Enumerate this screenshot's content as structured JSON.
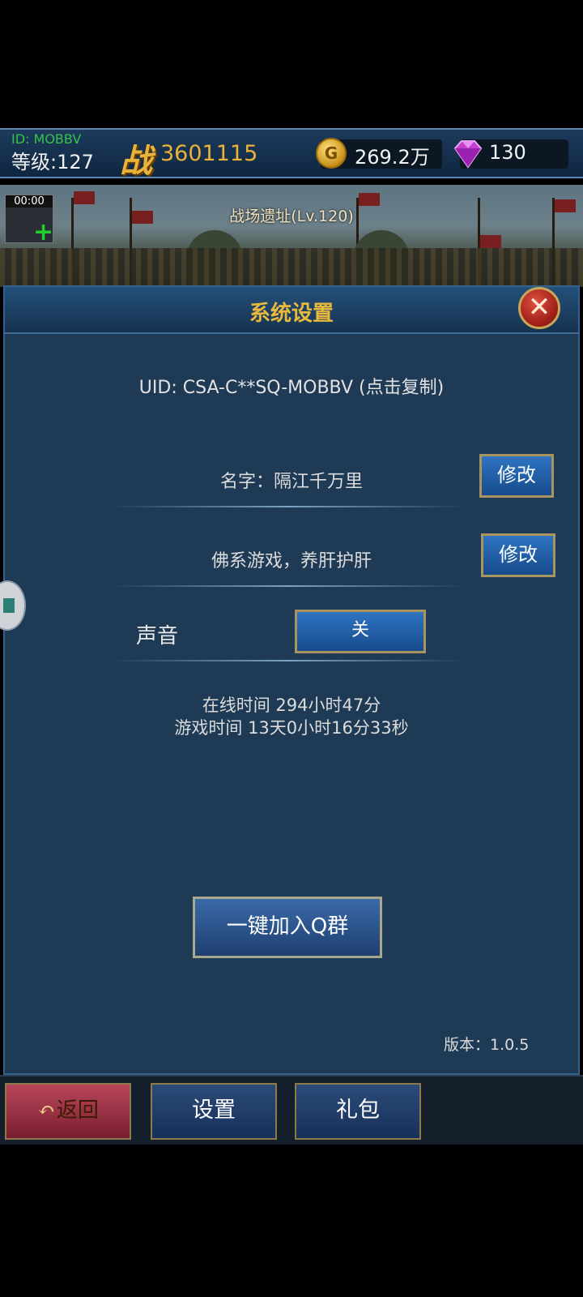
{
  "topbar": {
    "id_text": "ID: MOBBV",
    "level_text": "等级:127",
    "power_icon": "战",
    "power_value": "3601115",
    "gold_icon_letter": "G",
    "gold_value": "269.2万",
    "gem_icon": "diamond-icon",
    "gem_value": "130"
  },
  "scene": {
    "timer": "00:00",
    "location": "战场遗址(Lv.120)"
  },
  "dialog": {
    "title": "系统设置",
    "close_symbol": "✕",
    "uid_text": "UID: CSA-C**SQ-MOBBV (点击复制)",
    "name_text": "名字：隔江千万里",
    "name_edit": "修改",
    "signature_text": "佛系游戏，养肝护肝",
    "signature_edit": "修改",
    "sound_label": "声音",
    "sound_toggle": "关",
    "online_time": "在线时间 294小时47分",
    "game_time": "游戏时间 13天0小时16分33秒",
    "qgroup_button": "一键加入Q群",
    "version": "版本：1.0.5"
  },
  "bottom_nav": {
    "back_label": "返回",
    "settings_label": "设置",
    "gift_label": "礼包"
  },
  "colors": {
    "accent_gold": "#e8b93c",
    "panel_bg": "#1e3a55",
    "button_blue": "#2f74c2"
  }
}
